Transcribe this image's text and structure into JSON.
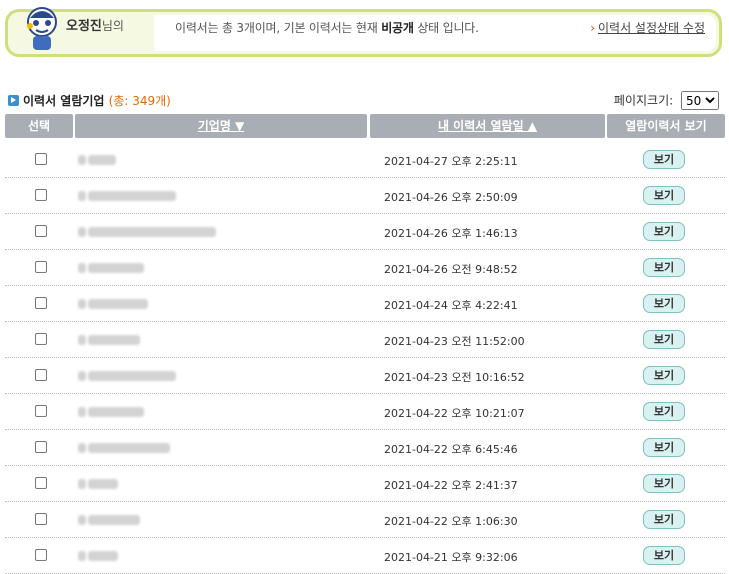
{
  "banner": {
    "user_name": "오정진",
    "user_suffix": "님의",
    "summary_pre": "이력서는 총 3개이며, 기본 이력서는 현재 ",
    "summary_bold": "비공개",
    "summary_post": " 상태 입니다.",
    "setting_link": "이력서 설정상태 수정"
  },
  "section": {
    "title": "이력서 열람기업",
    "count": "(총: 349개)",
    "page_size_label": "페이지크기:",
    "page_size_value": "50"
  },
  "table": {
    "headers": {
      "select": "선택",
      "company": "기업명 ▼",
      "viewed_at": "내 이력서 열람일 ▲",
      "view_resume": "열람이력서 보기"
    },
    "rows": [
      {
        "company_blur": [
          8,
          28
        ],
        "date": "2021-04-27 오후 2:25:11",
        "view": "보기"
      },
      {
        "company_blur": [
          8,
          88
        ],
        "date": "2021-04-26 오후 2:50:09",
        "view": "보기"
      },
      {
        "company_blur": [
          6,
          128
        ],
        "date": "2021-04-26 오후 1:46:13",
        "view": "보기"
      },
      {
        "company_blur": [
          8,
          56
        ],
        "date": "2021-04-26 오전 9:48:52",
        "view": "보기"
      },
      {
        "company_blur": [
          8,
          60
        ],
        "date": "2021-04-24 오후 4:22:41",
        "view": "보기"
      },
      {
        "company_blur": [
          8,
          52
        ],
        "date": "2021-04-23 오전 11:52:00",
        "view": "보기"
      },
      {
        "company_blur": [
          8,
          88
        ],
        "date": "2021-04-23 오전 10:16:52",
        "view": "보기"
      },
      {
        "company_blur": [
          8,
          56
        ],
        "date": "2021-04-22 오후 10:21:07",
        "view": "보기"
      },
      {
        "company_blur": [
          6,
          82
        ],
        "date": "2021-04-22 오후 6:45:46",
        "view": "보기"
      },
      {
        "company_blur": [
          8,
          30
        ],
        "date": "2021-04-22 오후 2:41:37",
        "view": "보기"
      },
      {
        "company_blur": [
          8,
          52
        ],
        "date": "2021-04-22 오후 1:06:30",
        "view": "보기"
      },
      {
        "company_blur": [
          8,
          30
        ],
        "date": "2021-04-21 오후 9:32:06",
        "view": "보기"
      }
    ]
  }
}
